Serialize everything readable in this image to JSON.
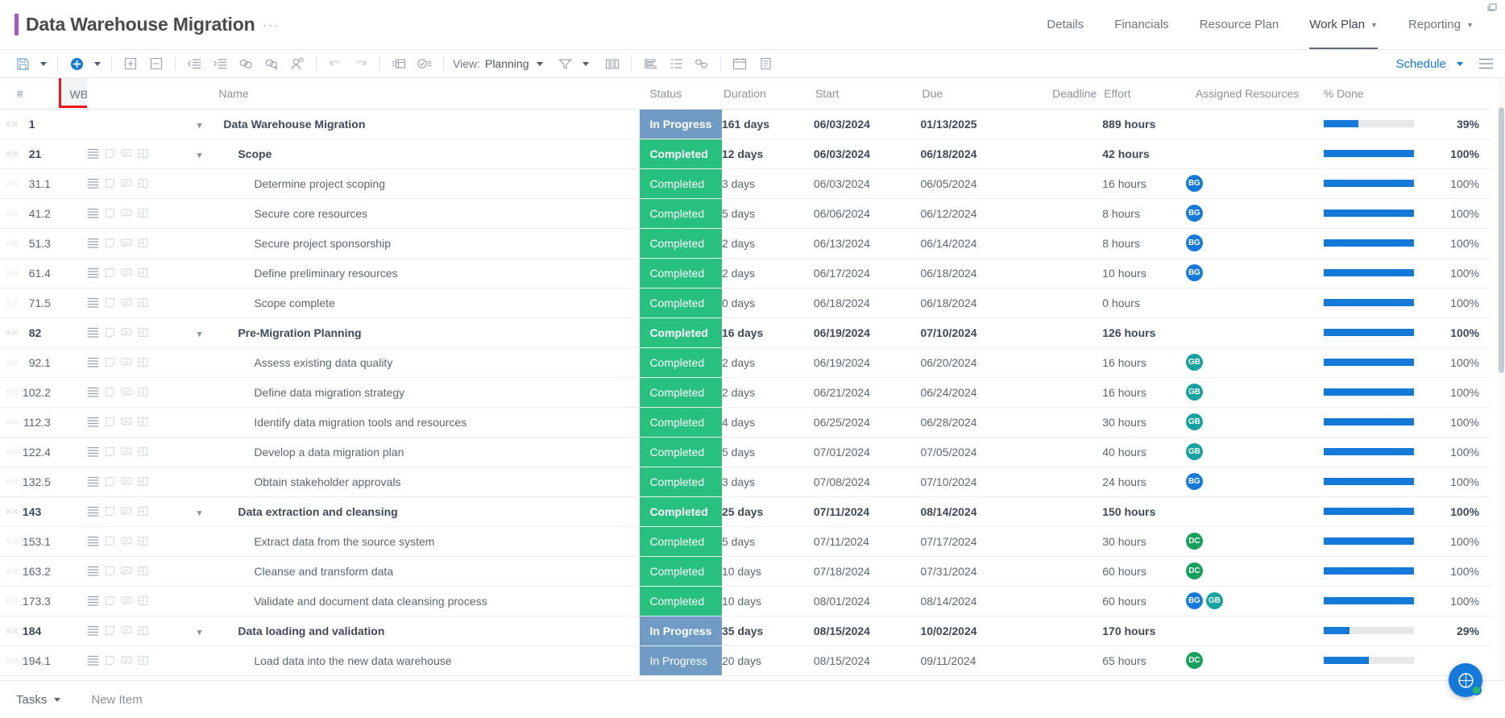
{
  "header": {
    "project_title": "Data Warehouse Migration",
    "title_menu_dots": "···",
    "nav": [
      {
        "label": "Details",
        "caret": false,
        "active": false
      },
      {
        "label": "Financials",
        "caret": false,
        "active": false
      },
      {
        "label": "Resource Plan",
        "caret": false,
        "active": false
      },
      {
        "label": "Work Plan",
        "caret": true,
        "active": true
      },
      {
        "label": "Reporting",
        "caret": true,
        "active": false
      }
    ]
  },
  "toolbar": {
    "view_label": "View:",
    "view_value": "Planning",
    "schedule_label": "Schedule",
    "icons": [
      "save-icon",
      "save-dropdown-caret",
      "add-icon",
      "add-dropdown-caret",
      "expand-all-icon",
      "collapse-all-icon",
      "outdent-icon",
      "indent-icon",
      "link-tasks-icon",
      "unlink-tasks-icon",
      "assign-resource-icon",
      "undo-icon",
      "redo-icon",
      "insert-row-icon",
      "checklist-icon",
      "filter-icon",
      "filter-caret",
      "columns-icon",
      "baseline-icon",
      "outline-icon",
      "critical-path-icon",
      "calendar-icon",
      "notes-icon"
    ]
  },
  "grid": {
    "columns": [
      {
        "key": "num",
        "label": "#"
      },
      {
        "key": "wbs",
        "label": "WBS",
        "sorted": "asc",
        "sort_arrow": "↑",
        "highlighted": true
      },
      {
        "key": "name",
        "label": "Name"
      },
      {
        "key": "status",
        "label": "Status"
      },
      {
        "key": "duration",
        "label": "Duration"
      },
      {
        "key": "start",
        "label": "Start"
      },
      {
        "key": "due",
        "label": "Due"
      },
      {
        "key": "deadline",
        "label": "Deadline"
      },
      {
        "key": "effort",
        "label": "Effort"
      },
      {
        "key": "resources",
        "label": "Assigned Resources"
      },
      {
        "key": "pct",
        "label": "% Done"
      }
    ],
    "status_colors": {
      "In Progress": "#6f9bc4",
      "Completed": "#27c07f"
    },
    "avatar_colors": {
      "BG": "#1479d8",
      "GB": "#17a2a2",
      "DC": "#15a05c"
    },
    "progress_color": "#1479d8",
    "progress_track_color": "#e6e8ea",
    "rows": [
      {
        "num": "1",
        "wbs": "",
        "name": "Data Warehouse Migration",
        "level": 0,
        "summary": true,
        "chevron": true,
        "rowicons": false,
        "status": "In Progress",
        "duration": "161 days",
        "start": "06/03/2024",
        "due": "01/13/2025",
        "deadline": "",
        "effort": "889 hours",
        "resources": [],
        "pct": 39,
        "pct_label": "39%"
      },
      {
        "num": "2",
        "wbs": "1",
        "name": "Scope",
        "level": 1,
        "summary": true,
        "chevron": true,
        "rowicons": true,
        "status": "Completed",
        "duration": "12 days",
        "start": "06/03/2024",
        "due": "06/18/2024",
        "deadline": "",
        "effort": "42 hours",
        "resources": [],
        "pct": 100,
        "pct_label": "100%"
      },
      {
        "num": "3",
        "wbs": "1.1",
        "name": "Determine project scoping",
        "level": 2,
        "summary": false,
        "chevron": false,
        "rowicons": true,
        "status": "Completed",
        "duration": "3 days",
        "start": "06/03/2024",
        "due": "06/05/2024",
        "deadline": "",
        "effort": "16 hours",
        "resources": [
          "BG"
        ],
        "pct": 100,
        "pct_label": "100%"
      },
      {
        "num": "4",
        "wbs": "1.2",
        "name": "Secure core resources",
        "level": 2,
        "summary": false,
        "chevron": false,
        "rowicons": true,
        "status": "Completed",
        "duration": "5 days",
        "start": "06/06/2024",
        "due": "06/12/2024",
        "deadline": "",
        "effort": "8 hours",
        "resources": [
          "BG"
        ],
        "pct": 100,
        "pct_label": "100%"
      },
      {
        "num": "5",
        "wbs": "1.3",
        "name": "Secure project sponsorship",
        "level": 2,
        "summary": false,
        "chevron": false,
        "rowicons": true,
        "status": "Completed",
        "duration": "2 days",
        "start": "06/13/2024",
        "due": "06/14/2024",
        "deadline": "",
        "effort": "8 hours",
        "resources": [
          "BG"
        ],
        "pct": 100,
        "pct_label": "100%"
      },
      {
        "num": "6",
        "wbs": "1.4",
        "name": "Define preliminary resources",
        "level": 2,
        "summary": false,
        "chevron": false,
        "rowicons": true,
        "status": "Completed",
        "duration": "2 days",
        "start": "06/17/2024",
        "due": "06/18/2024",
        "deadline": "",
        "effort": "10 hours",
        "resources": [
          "BG"
        ],
        "pct": 100,
        "pct_label": "100%"
      },
      {
        "num": "7",
        "wbs": "1.5",
        "name": "Scope complete",
        "level": 2,
        "summary": false,
        "chevron": false,
        "rowicons": true,
        "status": "Completed",
        "duration": "0 days",
        "start": "06/18/2024",
        "due": "06/18/2024",
        "deadline": "",
        "effort": "0 hours",
        "resources": [],
        "pct": 100,
        "pct_label": "100%"
      },
      {
        "num": "8",
        "wbs": "2",
        "name": "Pre-Migration Planning",
        "level": 1,
        "summary": true,
        "chevron": true,
        "rowicons": true,
        "status": "Completed",
        "duration": "16 days",
        "start": "06/19/2024",
        "due": "07/10/2024",
        "deadline": "",
        "effort": "126 hours",
        "resources": [],
        "pct": 100,
        "pct_label": "100%"
      },
      {
        "num": "9",
        "wbs": "2.1",
        "name": "Assess existing data quality",
        "level": 2,
        "summary": false,
        "chevron": false,
        "rowicons": true,
        "status": "Completed",
        "duration": "2 days",
        "start": "06/19/2024",
        "due": "06/20/2024",
        "deadline": "",
        "effort": "16 hours",
        "resources": [
          "GB"
        ],
        "pct": 100,
        "pct_label": "100%"
      },
      {
        "num": "10",
        "wbs": "2.2",
        "name": "Define data migration strategy",
        "level": 2,
        "summary": false,
        "chevron": false,
        "rowicons": true,
        "status": "Completed",
        "duration": "2 days",
        "start": "06/21/2024",
        "due": "06/24/2024",
        "deadline": "",
        "effort": "16 hours",
        "resources": [
          "GB"
        ],
        "pct": 100,
        "pct_label": "100%"
      },
      {
        "num": "11",
        "wbs": "2.3",
        "name": "Identify data migration tools and resources",
        "level": 2,
        "summary": false,
        "chevron": false,
        "rowicons": true,
        "status": "Completed",
        "duration": "4 days",
        "start": "06/25/2024",
        "due": "06/28/2024",
        "deadline": "",
        "effort": "30 hours",
        "resources": [
          "GB"
        ],
        "pct": 100,
        "pct_label": "100%"
      },
      {
        "num": "12",
        "wbs": "2.4",
        "name": "Develop a data migration plan",
        "level": 2,
        "summary": false,
        "chevron": false,
        "rowicons": true,
        "status": "Completed",
        "duration": "5 days",
        "start": "07/01/2024",
        "due": "07/05/2024",
        "deadline": "",
        "effort": "40 hours",
        "resources": [
          "GB"
        ],
        "pct": 100,
        "pct_label": "100%"
      },
      {
        "num": "13",
        "wbs": "2.5",
        "name": "Obtain stakeholder approvals",
        "level": 2,
        "summary": false,
        "chevron": false,
        "rowicons": true,
        "status": "Completed",
        "duration": "3 days",
        "start": "07/08/2024",
        "due": "07/10/2024",
        "deadline": "",
        "effort": "24 hours",
        "resources": [
          "BG"
        ],
        "pct": 100,
        "pct_label": "100%"
      },
      {
        "num": "14",
        "wbs": "3",
        "name": "Data extraction and cleansing",
        "level": 1,
        "summary": true,
        "chevron": true,
        "rowicons": true,
        "status": "Completed",
        "duration": "25 days",
        "start": "07/11/2024",
        "due": "08/14/2024",
        "deadline": "",
        "effort": "150 hours",
        "resources": [],
        "pct": 100,
        "pct_label": "100%"
      },
      {
        "num": "15",
        "wbs": "3.1",
        "name": "Extract data from the source system",
        "level": 2,
        "summary": false,
        "chevron": false,
        "rowicons": true,
        "status": "Completed",
        "duration": "5 days",
        "start": "07/11/2024",
        "due": "07/17/2024",
        "deadline": "",
        "effort": "30 hours",
        "resources": [
          "DC"
        ],
        "pct": 100,
        "pct_label": "100%"
      },
      {
        "num": "16",
        "wbs": "3.2",
        "name": "Cleanse and transform data",
        "level": 2,
        "summary": false,
        "chevron": false,
        "rowicons": true,
        "status": "Completed",
        "duration": "10 days",
        "start": "07/18/2024",
        "due": "07/31/2024",
        "deadline": "",
        "effort": "60 hours",
        "resources": [
          "DC"
        ],
        "pct": 100,
        "pct_label": "100%"
      },
      {
        "num": "17",
        "wbs": "3.3",
        "name": "Validate and document data cleansing process",
        "level": 2,
        "summary": false,
        "chevron": false,
        "rowicons": true,
        "status": "Completed",
        "duration": "10 days",
        "start": "08/01/2024",
        "due": "08/14/2024",
        "deadline": "",
        "effort": "60 hours",
        "resources": [
          "BG",
          "GB"
        ],
        "pct": 100,
        "pct_label": "100%"
      },
      {
        "num": "18",
        "wbs": "4",
        "name": "Data loading and validation",
        "level": 1,
        "summary": true,
        "chevron": true,
        "rowicons": true,
        "status": "In Progress",
        "duration": "35 days",
        "start": "08/15/2024",
        "due": "10/02/2024",
        "deadline": "",
        "effort": "170 hours",
        "resources": [],
        "pct": 29,
        "pct_label": "29%"
      },
      {
        "num": "19",
        "wbs": "4.1",
        "name": "Load data into the new data warehouse",
        "level": 2,
        "summary": false,
        "chevron": false,
        "rowicons": true,
        "status": "In Progress",
        "duration": "20 days",
        "start": "08/15/2024",
        "due": "09/11/2024",
        "deadline": "",
        "effort": "65 hours",
        "resources": [
          "DC"
        ],
        "pct": 50,
        "pct_label": ""
      }
    ]
  },
  "footer": {
    "tasks_label": "Tasks",
    "new_item_label": "New Item",
    "fab_icon": "help-chat-icon"
  }
}
